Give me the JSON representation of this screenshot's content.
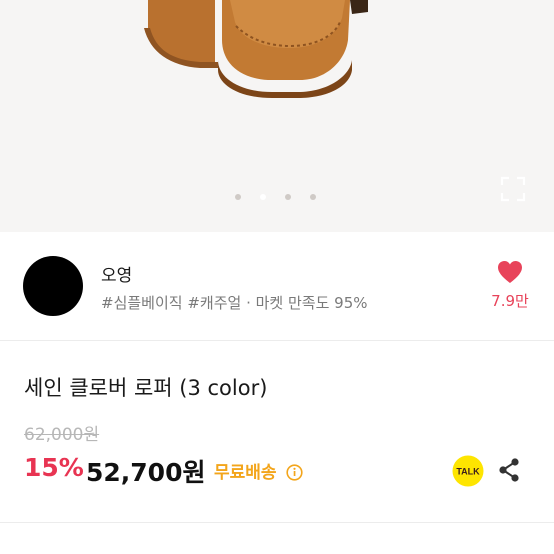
{
  "hero": {
    "image": "brown suede loafers product photo",
    "carousel": {
      "count": 4,
      "active_index": 1
    },
    "expand_icon": "expand-icon"
  },
  "seller": {
    "name": "오영",
    "tags": "#심플베이직 #캐주얼 · 마켓 만족도 95%",
    "likes": "7.9만",
    "colors": {
      "like": "#e8435a"
    }
  },
  "product": {
    "title": "세인 클로버 로퍼 (3 color)",
    "original_price": "62,000원",
    "discount": "15%",
    "price": "52,700원",
    "shipping": "무료배송",
    "talk_label": "TALK",
    "colors": {
      "discount": "#e83452",
      "shipping": "#f3a51b",
      "talk_bg": "#fee500"
    }
  }
}
